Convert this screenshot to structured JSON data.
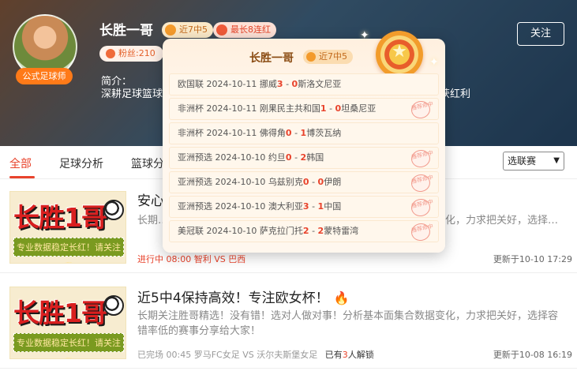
{
  "header": {
    "name": "长胜一哥",
    "avatar_tag": "公式足球师",
    "badge_win": "近7中5",
    "badge_streak": "最长8连红",
    "fans": "粉丝:210",
    "intro_label": "简介：",
    "intro_text": "深耕足球篮球…………………………………………………………据前端，稳获红利",
    "follow_label": "关注"
  },
  "tabs": {
    "all": "全部",
    "football": "足球分析",
    "basketball": "篮球分析"
  },
  "select": {
    "value": "选联赛"
  },
  "popup": {
    "name": "长胜一哥",
    "badge": "近7中5",
    "matches": [
      {
        "text_a": "欧国联 2024-10-11 挪威",
        "h": "3",
        "dash": " - ",
        "a": "0",
        "text_b": "斯洛文尼亚",
        "hit": false
      },
      {
        "text_a": "非洲杯 2024-10-11 刚果民主共和国",
        "h": "1",
        "dash": " - ",
        "a": "0",
        "text_b": "坦桑尼亚",
        "hit": true
      },
      {
        "text_a": "非洲杯 2024-10-11 佛得角",
        "h": "0",
        "dash": " - ",
        "a": "1",
        "text_b": "博茨瓦纳",
        "hit": false
      },
      {
        "text_a": "亚洲预选 2024-10-10 约旦",
        "h": "0",
        "dash": " - ",
        "a": "2",
        "text_b": "韩国",
        "hit": true
      },
      {
        "text_a": "亚洲预选 2024-10-10 乌兹别克",
        "h": "0",
        "dash": " - ",
        "a": "0",
        "text_b": "伊朗",
        "hit": true
      },
      {
        "text_a": "亚洲预选 2024-10-10 澳大利亚",
        "h": "3",
        "dash": " - ",
        "a": "1",
        "text_b": "中国",
        "hit": true
      },
      {
        "text_a": "美冠联 2024-10-10 萨克拉门托",
        "h": "2",
        "dash": " - ",
        "a": "2",
        "text_b": "蒙特雷湾",
        "hit": true
      }
    ],
    "stamp_text": "推荐命中"
  },
  "thumb": {
    "big_text": "长胜1哥",
    "strip_text": "专业数据稳定长红！请关注我"
  },
  "articles": [
    {
      "title": "安心…",
      "desc": "长期…………………………………………………………………数据变化，力求把关好，选择…",
      "status": "进行中",
      "time": "08:00",
      "match": "智利 VS 巴西",
      "unlock_prefix": "",
      "unlock_count": "",
      "unlock_suffix": "",
      "updated": "更新于10-10 17:29"
    },
    {
      "title": "近5中4保持高效！专注欧女杯！",
      "desc": "长期关注胜哥精选！没有错！选对人做对事！分析基本面集合数据变化，力求把关好，选择容错率低的赛事分享给大家！",
      "status": "已完场",
      "time": "00:45",
      "match": "罗马FC女足 VS 沃尔夫斯堡女足",
      "unlock_prefix": "已有",
      "unlock_count": "3",
      "unlock_suffix": "人解锁",
      "updated": "更新于10-08 16:19"
    }
  ]
}
